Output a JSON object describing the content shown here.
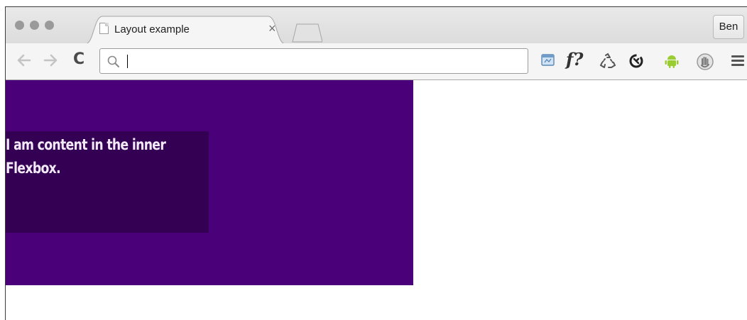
{
  "tab": {
    "title": "Layout example",
    "close_glyph": "×"
  },
  "profile": {
    "name": "Ben"
  },
  "toolbar": {
    "back_icon": "back-arrow-icon",
    "forward_icon": "forward-arrow-icon",
    "reload_icon": "reload-icon",
    "reload_glyph": "C",
    "omnibox_value": "",
    "extensions": [
      {
        "name": "browser-window-icon"
      },
      {
        "name": "font-finder-icon",
        "label": "f?"
      },
      {
        "name": "recycle-icon"
      },
      {
        "name": "sync-icon"
      },
      {
        "name": "android-icon"
      },
      {
        "name": "hand-icon"
      },
      {
        "name": "menu-icon"
      }
    ]
  },
  "page": {
    "inner_content": "I am content in the inner Flexbox.",
    "colors": {
      "outer": "#4a0078",
      "inner": "#330054",
      "text": "#f3eaf8"
    }
  }
}
